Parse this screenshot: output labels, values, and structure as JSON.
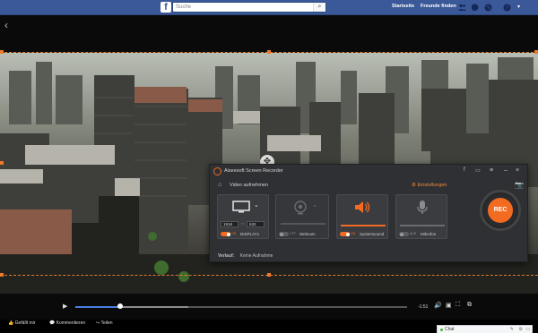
{
  "facebook": {
    "logo_letter": "f",
    "search_placeholder": "Suche",
    "nav": [
      "Startseite",
      "Freunde finden"
    ]
  },
  "recorder": {
    "title": "Aiseesoft Screen Recorder",
    "breadcrumb": "Video aufnehmen",
    "settings_label": "Einstellungen",
    "display": {
      "width": "1918",
      "height": "632",
      "toggle": "ON",
      "label": "DISPLAY1"
    },
    "webcam": {
      "toggle": "OFF",
      "label": "Webcam"
    },
    "system_sound": {
      "toggle": "ON",
      "label": "Systemsound"
    },
    "microphone": {
      "toggle": "AUS",
      "label": "Mikrofon"
    },
    "history_label": "Verlauf:",
    "history_value": "Keine Aufnahme",
    "rec_label": "REC"
  },
  "player": {
    "time": "-1:51",
    "progress_fraction": 0.135,
    "buffered_fraction": 0.34
  },
  "bottom": {
    "like": "Gefällt mir",
    "comment": "Kommentieren",
    "share": "Teilen",
    "chat": "Chat"
  }
}
